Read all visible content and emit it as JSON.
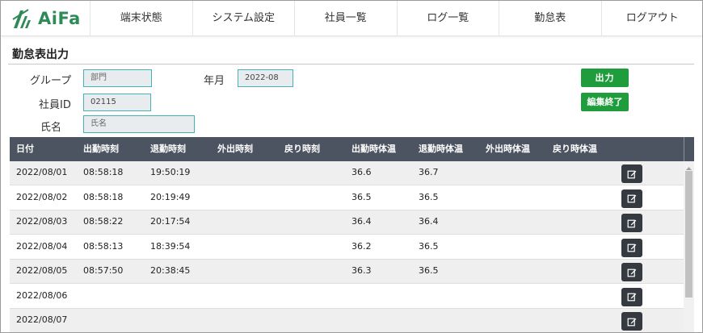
{
  "app": {
    "logo_text": "AiFa"
  },
  "nav": [
    "端末状態",
    "システム設定",
    "社員一覧",
    "ログ一覧",
    "勤怠表",
    "ログアウト"
  ],
  "page": {
    "title": "勤怠表出力"
  },
  "form": {
    "group_label": "グループ",
    "group_placeholder": "部門",
    "yearmonth_label": "年月",
    "yearmonth_value": "2022-08",
    "empid_label": "社員ID",
    "empid_value": "02115",
    "name_label": "氏名",
    "name_placeholder": "氏名",
    "output_button": "出力",
    "finish_button": "編集終了"
  },
  "table": {
    "headers": [
      "日付",
      "出勤時刻",
      "退勤時刻",
      "外出時刻",
      "戻り時刻",
      "出勤時体温",
      "退勤時体温",
      "外出時体温",
      "戻り時体温"
    ],
    "rows": [
      [
        "2022/08/01",
        "08:58:18",
        "19:50:19",
        "",
        "",
        "36.6",
        "36.7",
        "",
        ""
      ],
      [
        "2022/08/02",
        "08:58:18",
        "20:19:49",
        "",
        "",
        "36.5",
        "36.5",
        "",
        ""
      ],
      [
        "2022/08/03",
        "08:58:22",
        "20:17:54",
        "",
        "",
        "36.4",
        "36.4",
        "",
        ""
      ],
      [
        "2022/08/04",
        "08:58:13",
        "18:39:54",
        "",
        "",
        "36.2",
        "36.5",
        "",
        ""
      ],
      [
        "2022/08/05",
        "08:57:50",
        "20:38:45",
        "",
        "",
        "36.3",
        "36.5",
        "",
        ""
      ],
      [
        "2022/08/06",
        "",
        "",
        "",
        "",
        "",
        "",
        "",
        ""
      ],
      [
        "2022/08/07",
        "",
        "",
        "",
        "",
        "",
        "",
        "",
        ""
      ]
    ],
    "row_icon": "edit-icon"
  },
  "colors": {
    "brand_green": "#2e8a57",
    "button_green": "#1f9d3c",
    "header_bg": "#4d5461",
    "input_border": "#45b2b5",
    "edit_button_bg": "#343a40"
  }
}
